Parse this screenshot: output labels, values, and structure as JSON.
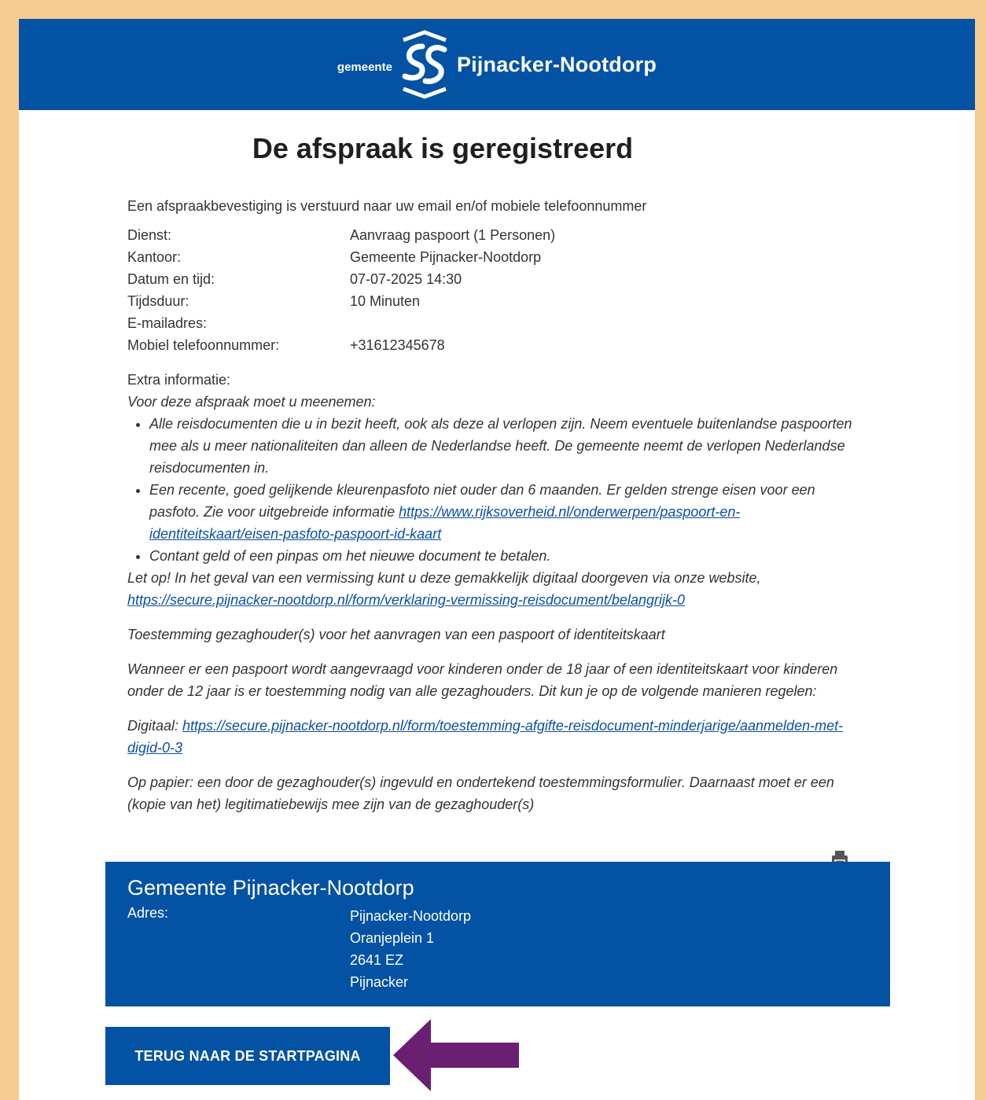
{
  "header": {
    "logo_small": "gemeente",
    "logo_name": "Pijnacker-Nootdorp"
  },
  "title": "De afspraak is geregistreerd",
  "confirmation": "Een afspraakbevestiging is verstuurd naar uw email en/of mobiele telefoonnummer",
  "details": [
    {
      "label": "Dienst:",
      "value": "Aanvraag paspoort (1 Personen)"
    },
    {
      "label": "Kantoor:",
      "value": "Gemeente Pijnacker-Nootdorp"
    },
    {
      "label": "Datum en tijd:",
      "value": "07-07-2025 14:30"
    },
    {
      "label": "Tijdsduur:",
      "value": "10 Minuten"
    },
    {
      "label": "E-mailadres:",
      "value": ""
    },
    {
      "label": "Mobiel telefoonnummer:",
      "value": "+31612345678"
    }
  ],
  "extra": {
    "label": "Extra informatie:",
    "intro": "Voor deze afspraak moet u meenemen:",
    "item1": "Alle reisdocumenten die u in bezit heeft, ook als deze al verlopen zijn. Neem eventuele buitenlandse paspoorten mee als u meer nationaliteiten dan alleen de Nederlandse heeft. De gemeente neemt de verlopen Nederlandse reisdocumenten in.",
    "item2_text": "Een recente, goed gelijkende kleurenpasfoto niet ouder dan 6 maanden. Er gelden strenge eisen voor een pasfoto. Zie voor uitgebreide informatie ",
    "item2_link": "https://www.rijksoverheid.nl/onderwerpen/paspoort-en-identiteitskaart/eisen-pasfoto-paspoort-id-kaart",
    "item3": "Contant geld of een pinpas om het nieuwe document te betalen.",
    "note_text": "Let op! In het geval van een vermissing kunt u deze gemakkelijk digitaal doorgeven via onze website, ",
    "note_link": "https://secure.pijnacker-nootdorp.nl/form/verklaring-vermissing-reisdocument/belangrijk-0",
    "consent_title": "Toestemming gezaghouder(s) voor het aanvragen van een paspoort of identiteitskaart",
    "consent_text": "Wanneer er een paspoort wordt aangevraagd voor kinderen onder de 18 jaar of een identiteitskaart voor kinderen onder de 12 jaar is er toestemming nodig van alle gezaghouders. Dit kun je op de volgende manieren regelen:",
    "digital_label": "Digitaal: ",
    "digital_link": "https://secure.pijnacker-nootdorp.nl/form/toestemming-afgifte-reisdocument-minderjarige/aanmelden-met-digid-0-3",
    "paper_text": "Op papier: een door de gezaghouder(s) ingevuld en ondertekend toestemmingsformulier. Daarnaast moet er een (kopie van het) legitimatiebewijs mee zijn van de gezaghouder(s)"
  },
  "address": {
    "name": "Gemeente Pijnacker-Nootdorp",
    "label": "Adres:",
    "line1": "Pijnacker-Nootdorp",
    "line2": "Oranjeplein 1",
    "line3": "2641 EZ",
    "line4": "Pijnacker"
  },
  "back_button": "TERUG NAAR DE STARTPAGINA",
  "icons": {
    "print": "printer-icon",
    "arrow": "arrow-left-icon"
  },
  "colors": {
    "brand_blue": "#0352a4",
    "frame": "#f6cc92",
    "arrow": "#6a1f73"
  }
}
